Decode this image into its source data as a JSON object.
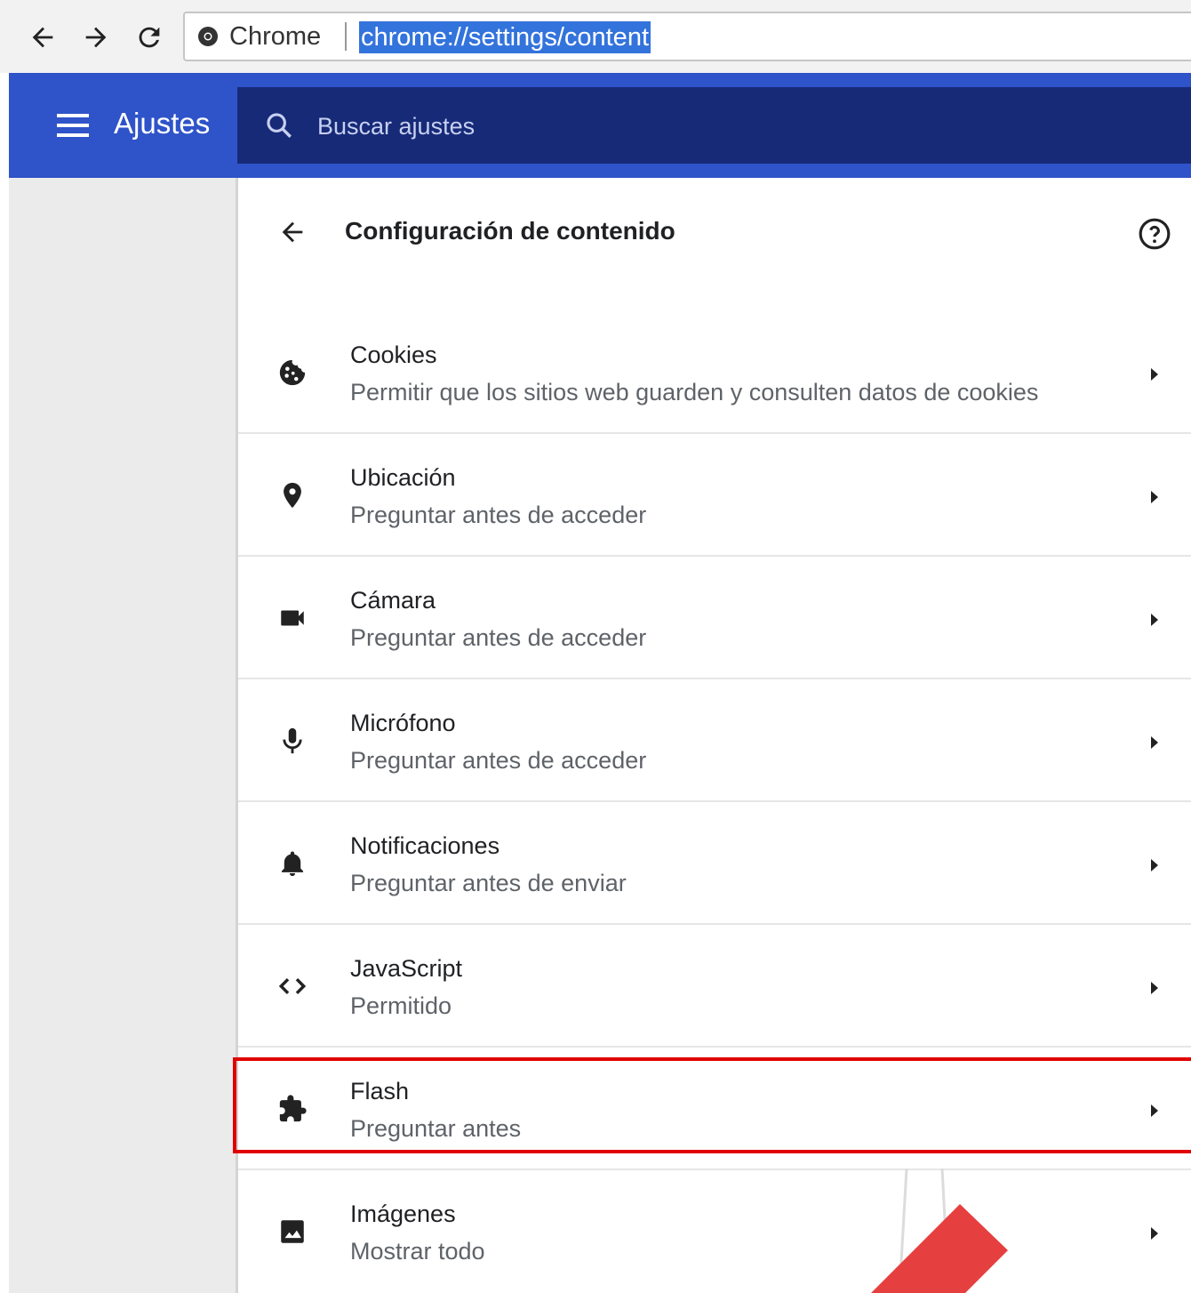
{
  "browser": {
    "site_label": "Chrome",
    "url": "chrome://settings/content",
    "icons": [
      "back-arrow-icon",
      "forward-arrow-icon",
      "reload-icon",
      "chrome-icon"
    ]
  },
  "header": {
    "title": "Ajustes",
    "search_placeholder": "Buscar ajustes"
  },
  "page": {
    "title": "Configuración de contenido"
  },
  "rows": [
    {
      "title": "Cookies",
      "subtitle": "Permitir que los sitios web guarden y consulten datos de cookies",
      "icon": "cookie-icon"
    },
    {
      "title": "Ubicación",
      "subtitle": "Preguntar antes de acceder",
      "icon": "location-pin-icon"
    },
    {
      "title": "Cámara",
      "subtitle": "Preguntar antes de acceder",
      "icon": "camera-icon"
    },
    {
      "title": "Micrófono",
      "subtitle": "Preguntar antes de acceder",
      "icon": "microphone-icon"
    },
    {
      "title": "Notificaciones",
      "subtitle": "Preguntar antes de enviar",
      "icon": "bell-icon"
    },
    {
      "title": "JavaScript",
      "subtitle": "Permitido",
      "icon": "code-icon"
    },
    {
      "title": "Flash",
      "subtitle": "Preguntar antes",
      "icon": "puzzle-icon"
    },
    {
      "title": "Imágenes",
      "subtitle": "Mostrar todo",
      "icon": "image-icon"
    }
  ],
  "colors": {
    "header_blue": "#2f53c8",
    "search_blue": "#172a78",
    "highlight_red": "#e00000",
    "arrow_red": "#e5403f"
  }
}
